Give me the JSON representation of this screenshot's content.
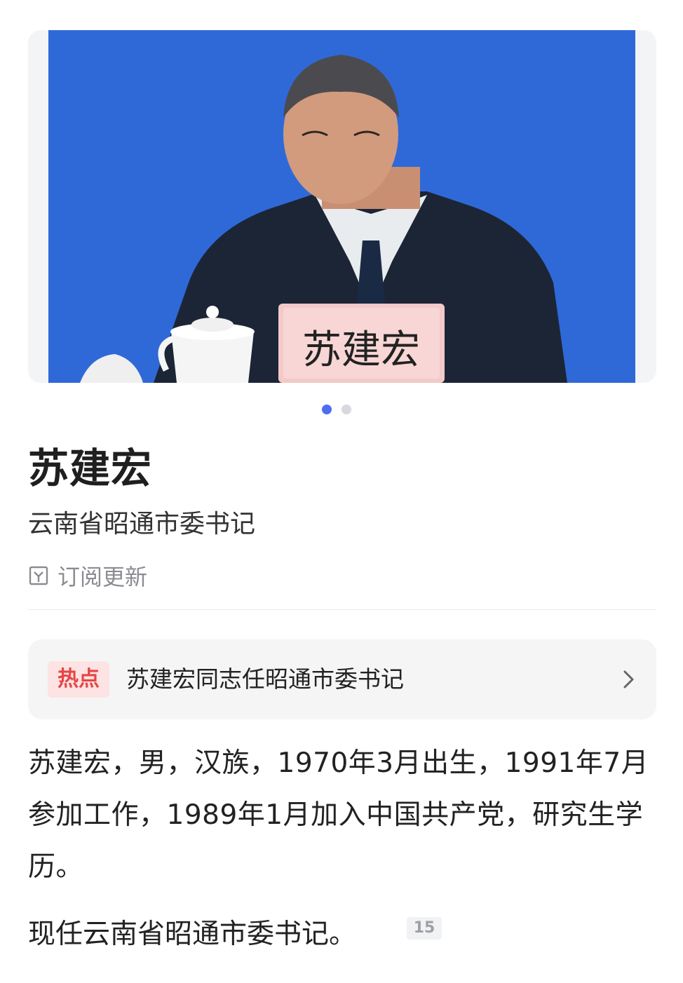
{
  "photo": {
    "nameplate_text": "苏建宏",
    "pager": {
      "count": 2,
      "active_index": 0
    }
  },
  "profile": {
    "name": "苏建宏",
    "title": "云南省昭通市委书记",
    "subscribe_label": "订阅更新"
  },
  "hot": {
    "badge": "热点",
    "headline": "苏建宏同志任昭通市委书记"
  },
  "bio": {
    "paragraph": "苏建宏，男，汉族，1970年3月出生，1991年7月参加工作，1989年1月加入中国共产党，研究生学历。",
    "current_post": "现任云南省昭通市委书记。",
    "reference_count": "15"
  },
  "colors": {
    "accent": "#4e6ef2",
    "hot_red": "#e64545",
    "photo_bg": "#2f69d8"
  }
}
